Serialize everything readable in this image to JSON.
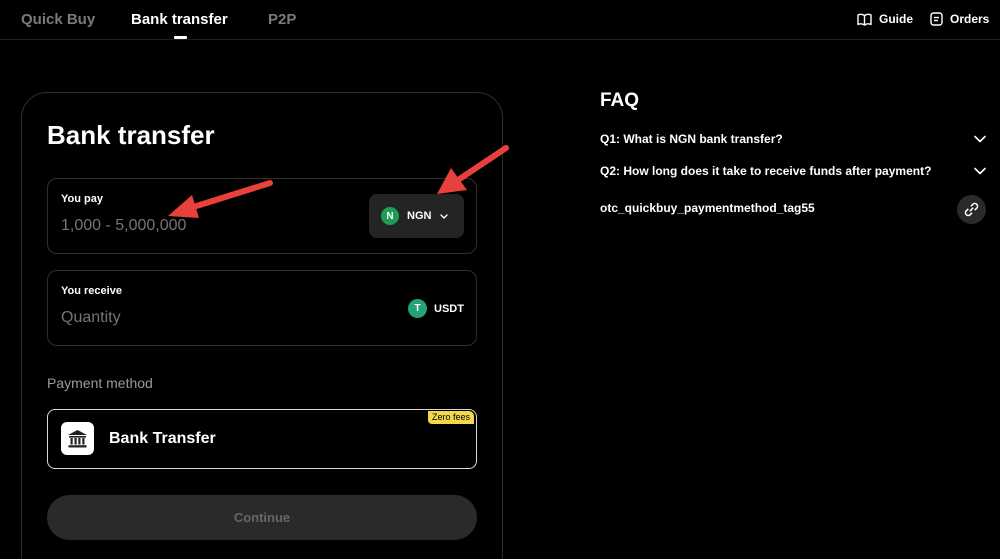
{
  "nav": {
    "tabs": [
      {
        "label": "Quick Buy"
      },
      {
        "label": "Bank transfer"
      },
      {
        "label": "P2P"
      }
    ],
    "guide_label": "Guide",
    "orders_label": "Orders"
  },
  "card": {
    "title": "Bank transfer",
    "you_pay": {
      "label": "You pay",
      "placeholder": "1,000 - 5,000,000",
      "currency": "NGN",
      "currency_icon": "N"
    },
    "you_receive": {
      "label": "You receive",
      "placeholder": "Quantity",
      "currency": "USDT",
      "currency_icon": "T"
    },
    "payment_method_label": "Payment method",
    "payment_method": {
      "name": "Bank Transfer",
      "badge": "Zero fees"
    },
    "continue_label": "Continue"
  },
  "faq": {
    "title": "FAQ",
    "questions": [
      {
        "text": "Q1: What is NGN bank transfer?"
      },
      {
        "text": "Q2: How long does it take to receive funds after payment?"
      }
    ],
    "tag": "otc_quickbuy_paymentmethod_tag55"
  },
  "colors": {
    "background": "#000000",
    "ngn_green": "#1f9d55",
    "usdt_green": "#26a17b",
    "badge_yellow": "#f4d84a",
    "arrow_red": "#e8403a"
  }
}
